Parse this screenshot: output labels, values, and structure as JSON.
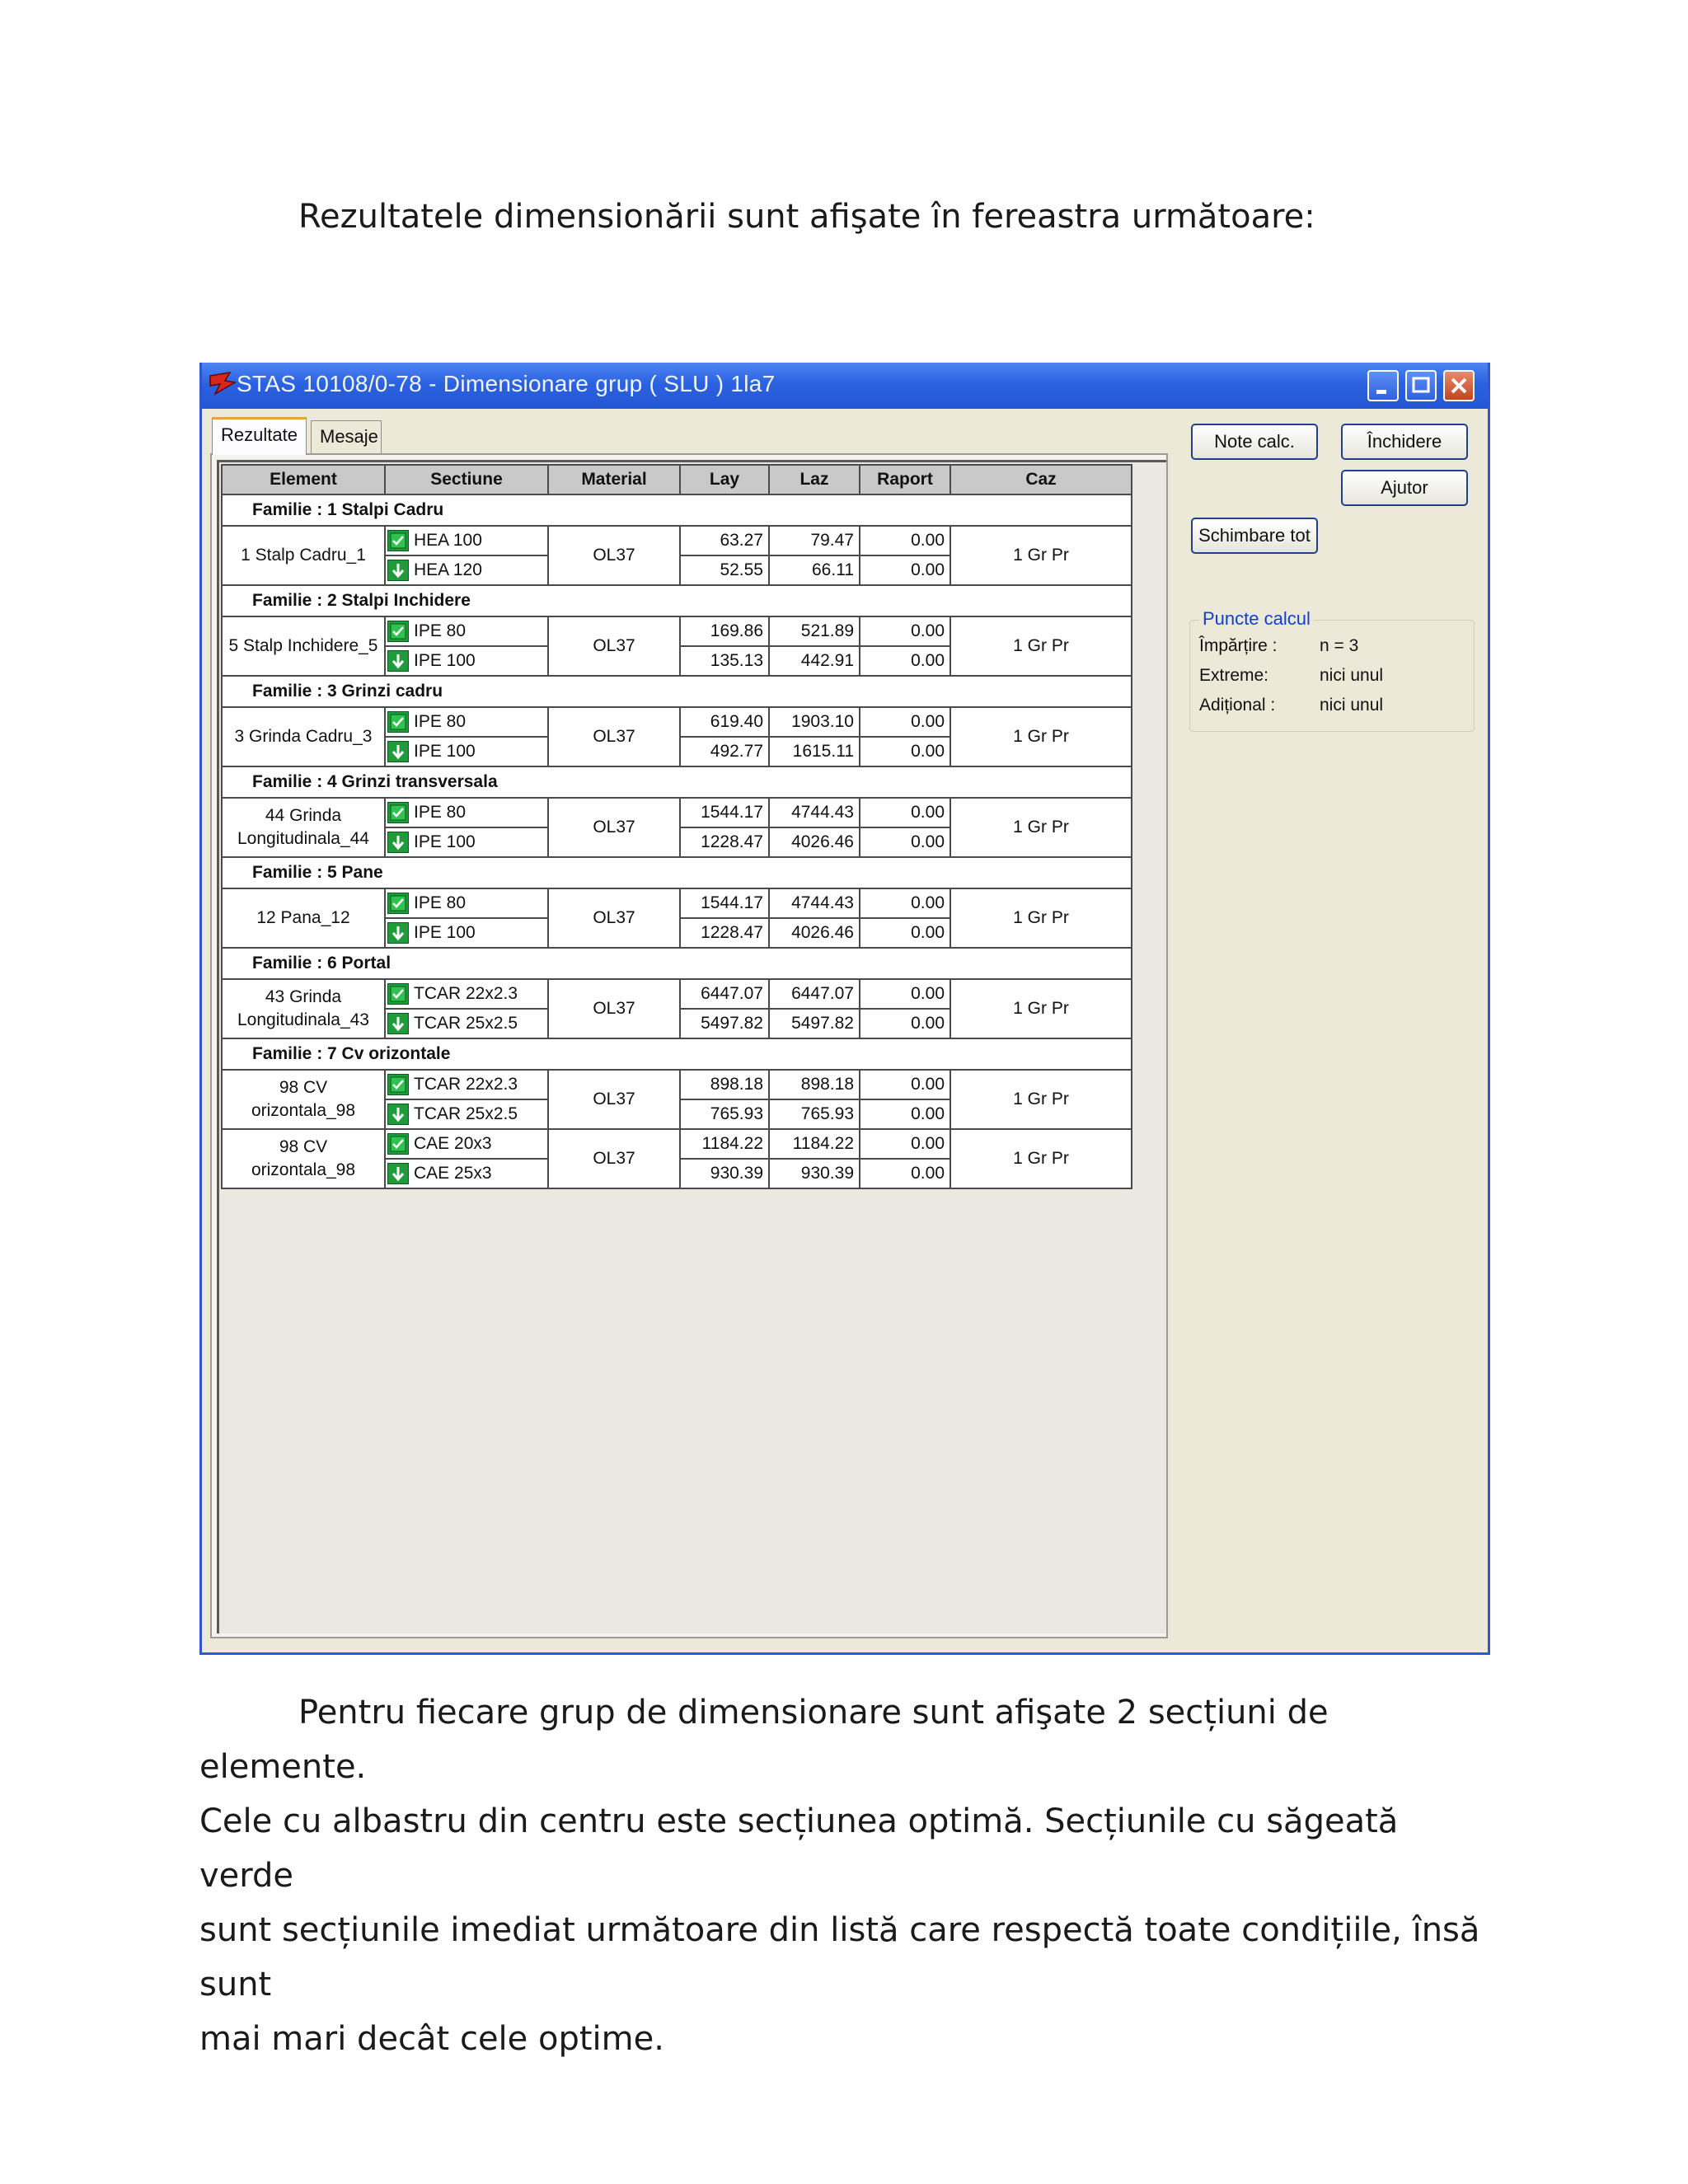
{
  "intro_text": "Rezultatele dimensionării sunt afişate în fereastra următoare:",
  "window": {
    "title": "STAS 10108/0-78 - Dimensionare grup ( SLU ) 1la7",
    "tabs": [
      "Rezultate",
      "Mesaje"
    ],
    "buttons": {
      "note": "Note calc.",
      "close": "Închidere",
      "help": "Ajutor",
      "change_all": "Schimbare tot"
    },
    "calc_points": {
      "title": "Puncte calcul",
      "rows": [
        {
          "label": "Împărțire :",
          "value": "n = 3"
        },
        {
          "label": "Extreme:",
          "value": "nici unul"
        },
        {
          "label": "Adițional :",
          "value": "nici unul"
        }
      ]
    },
    "table": {
      "headers": [
        "Element",
        "Sectiune",
        "Material",
        "Lay",
        "Laz",
        "Raport",
        "Caz"
      ],
      "families": [
        {
          "title": "Familie :  1  Stalpi Cadru",
          "groups": [
            {
              "element": "1  Stalp Cadru_1",
              "material": "OL37",
              "caz": "1 Gr Pr",
              "rows": [
                {
                  "icon": "ok",
                  "sec": "HEA 100",
                  "lay": "63.27",
                  "laz": "79.47",
                  "raport": "0.00"
                },
                {
                  "icon": "down",
                  "sec": "HEA 120",
                  "lay": "52.55",
                  "laz": "66.11",
                  "raport": "0.00"
                }
              ]
            }
          ]
        },
        {
          "title": "Familie :  2  Stalpi Inchidere",
          "groups": [
            {
              "element": "5  Stalp Inchidere_5",
              "material": "OL37",
              "caz": "1 Gr Pr",
              "rows": [
                {
                  "icon": "ok",
                  "sec": "IPE 80",
                  "lay": "169.86",
                  "laz": "521.89",
                  "raport": "0.00"
                },
                {
                  "icon": "down",
                  "sec": "IPE 100",
                  "lay": "135.13",
                  "laz": "442.91",
                  "raport": "0.00"
                }
              ]
            }
          ]
        },
        {
          "title": "Familie :  3  Grinzi cadru",
          "groups": [
            {
              "element": "3  Grinda Cadru_3",
              "material": "OL37",
              "caz": "1 Gr Pr",
              "rows": [
                {
                  "icon": "ok",
                  "sec": "IPE 80",
                  "lay": "619.40",
                  "laz": "1903.10",
                  "raport": "0.00"
                },
                {
                  "icon": "down",
                  "sec": "IPE 100",
                  "lay": "492.77",
                  "laz": "1615.11",
                  "raport": "0.00"
                }
              ]
            }
          ]
        },
        {
          "title": "Familie :  4  Grinzi transversala",
          "groups": [
            {
              "element": "44  Grinda Longitudinala_44",
              "material": "OL37",
              "caz": "1 Gr Pr",
              "rows": [
                {
                  "icon": "ok",
                  "sec": "IPE 80",
                  "lay": "1544.17",
                  "laz": "4744.43",
                  "raport": "0.00"
                },
                {
                  "icon": "down",
                  "sec": "IPE 100",
                  "lay": "1228.47",
                  "laz": "4026.46",
                  "raport": "0.00"
                }
              ]
            }
          ]
        },
        {
          "title": "Familie :  5  Pane",
          "groups": [
            {
              "element": "12  Pana_12",
              "material": "OL37",
              "caz": "1 Gr Pr",
              "rows": [
                {
                  "icon": "ok",
                  "sec": "IPE 80",
                  "lay": "1544.17",
                  "laz": "4744.43",
                  "raport": "0.00"
                },
                {
                  "icon": "down",
                  "sec": "IPE 100",
                  "lay": "1228.47",
                  "laz": "4026.46",
                  "raport": "0.00"
                }
              ]
            }
          ]
        },
        {
          "title": "Familie :  6  Portal",
          "groups": [
            {
              "element": "43  Grinda Longitudinala_43",
              "material": "OL37",
              "caz": "1 Gr Pr",
              "rows": [
                {
                  "icon": "ok",
                  "sec": "TCAR 22x2.3",
                  "lay": "6447.07",
                  "laz": "6447.07",
                  "raport": "0.00"
                },
                {
                  "icon": "down",
                  "sec": "TCAR 25x2.5",
                  "lay": "5497.82",
                  "laz": "5497.82",
                  "raport": "0.00"
                }
              ]
            }
          ]
        },
        {
          "title": "Familie :  7  Cv orizontale",
          "groups": [
            {
              "element": "98  CV orizontala_98",
              "material": "OL37",
              "caz": "1 Gr Pr",
              "rows": [
                {
                  "icon": "ok",
                  "sec": "TCAR 22x2.3",
                  "lay": "898.18",
                  "laz": "898.18",
                  "raport": "0.00"
                },
                {
                  "icon": "down",
                  "sec": "TCAR 25x2.5",
                  "lay": "765.93",
                  "laz": "765.93",
                  "raport": "0.00"
                }
              ]
            },
            {
              "element": "98  CV orizontala_98",
              "material": "OL37",
              "caz": "1 Gr Pr",
              "rows": [
                {
                  "icon": "ok",
                  "sec": "CAE 20x3",
                  "lay": "1184.22",
                  "laz": "1184.22",
                  "raport": "0.00"
                },
                {
                  "icon": "down",
                  "sec": "CAE 25x3",
                  "lay": "930.39",
                  "laz": "930.39",
                  "raport": "0.00"
                }
              ]
            }
          ]
        }
      ]
    }
  },
  "outro_text": [
    "Pentru fiecare grup de dimensionare sunt afişate 2 secțiuni de elemente.",
    "Cele cu albastru din centru este secțiunea optimă. Secțiunile cu săgeată verde",
    "sunt secțiunile imediat următoare din listă care respectă toate condițiile, însă sunt",
    "mai mari decât cele optime."
  ]
}
